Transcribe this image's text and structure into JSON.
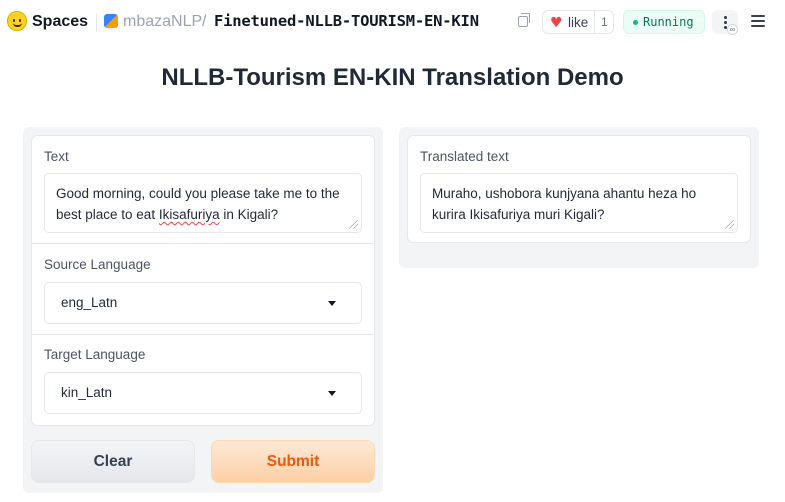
{
  "header": {
    "brand": "Spaces",
    "owner": "mbazaNLP",
    "separator": "/",
    "repo": "Finetuned-NLLB-TOURISM-EN-KIN",
    "like_label": "like",
    "like_count": "1",
    "status": "Running",
    "status_color": "#10b981"
  },
  "page_title": "NLLB-Tourism EN-KIN Translation Demo",
  "inputs": {
    "text_label": "Text",
    "text_value_before": "Good morning, could you please take me to the best place to eat ",
    "text_value_flagged": "Ikisafuriya",
    "text_value_after": " in Kigali?",
    "source_label": "Source Language",
    "source_value": "eng_Latn",
    "target_label": "Target Language",
    "target_value": "kin_Latn"
  },
  "buttons": {
    "clear": "Clear",
    "submit": "Submit",
    "submit_color": "#ea580c"
  },
  "output": {
    "label": "Translated text",
    "value": "Muraho, ushobora kunjyana ahantu heza ho kurira Ikisafuriya muri Kigali?"
  }
}
